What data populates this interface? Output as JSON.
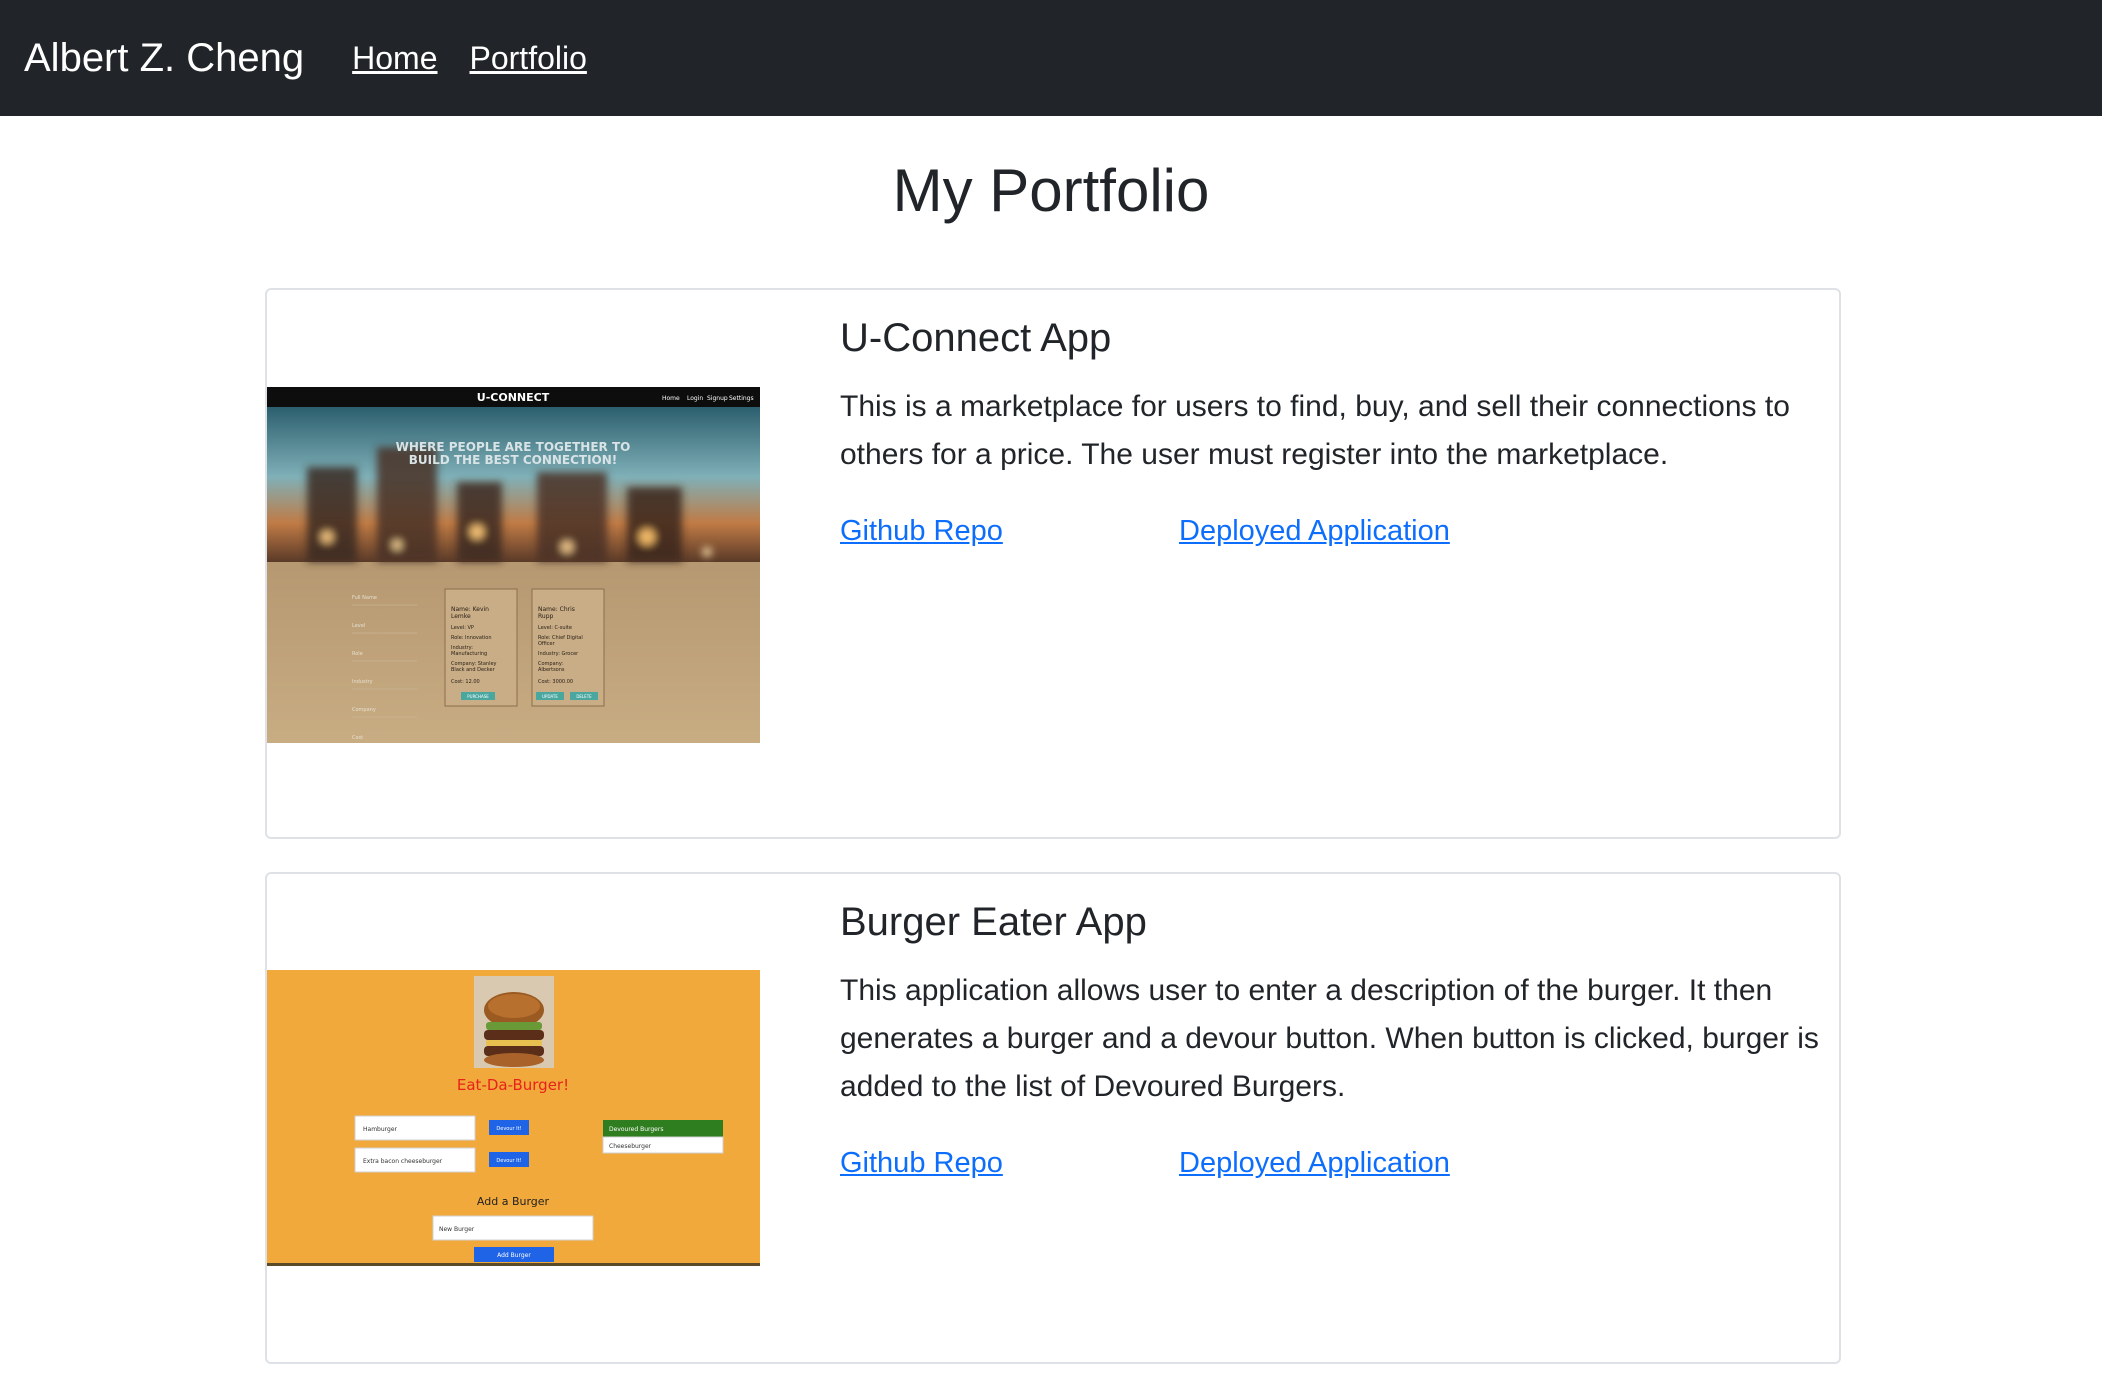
{
  "navbar": {
    "brand": "Albert Z. Cheng",
    "links": [
      {
        "label": "Home"
      },
      {
        "label": "Portfolio"
      }
    ]
  },
  "page": {
    "title": "My Portfolio"
  },
  "projects": [
    {
      "title": "U-Connect App",
      "description": "This is a marketplace for users to find, buy, and sell their connections to others for a price. The user must register into the marketplace.",
      "repo_label": "Github Repo",
      "deploy_label": "Deployed Application",
      "screenshot": {
        "app_name": "U-CONNECT",
        "nav": [
          "Home",
          "Login",
          "Signup",
          "Settings"
        ],
        "tagline_line1": "WHERE PEOPLE ARE TOGETHER TO",
        "tagline_line2": "BUILD THE BEST CONNECTION!",
        "form_fields": [
          "Full Name",
          "Level",
          "Role",
          "Industry",
          "Company",
          "Cost"
        ],
        "cards": [
          {
            "lines": [
              "Name: Kevin",
              "Lemke",
              "Level: VP",
              "Role: Innovation",
              "Industry:",
              "Manufacturing",
              "Company: Stanley",
              "Black and Decker",
              "Cost: 12.00"
            ],
            "buttons": [
              "PURCHASE"
            ]
          },
          {
            "lines": [
              "Name: Chris",
              "Rupp",
              "Level: C-suite",
              "Role: Chief Digital",
              "Officer",
              "Industry: Grocer",
              "Company:",
              "Albertsons",
              "Cost: 3000.00"
            ],
            "buttons": [
              "UPDATE",
              "DELETE"
            ]
          }
        ]
      }
    },
    {
      "title": "Burger Eater App",
      "description": "This application allows user to enter a description of the burger. It then generates a burger and a devour button. When button is clicked, burger is added to the list of Devoured Burgers.",
      "repo_label": "Github Repo",
      "deploy_label": "Deployed Application",
      "screenshot": {
        "heading": "Eat-Da-Burger!",
        "burgers": [
          "Hamburger",
          "Extra bacon cheeseburger"
        ],
        "devour_label": "Devour It!",
        "devoured_header": "Devoured Burgers",
        "devoured_items": [
          "Cheeseburger"
        ],
        "add_heading": "Add a Burger",
        "add_placeholder": "New Burger",
        "add_button": "Add Burger"
      }
    }
  ],
  "colors": {
    "navbar_bg": "#212529",
    "link": "#0d6efd",
    "burger_bg": "#f2a93b",
    "burger_title": "#e8221b",
    "burger_button": "#1f63e6",
    "devoured_header": "#2e7d1e"
  }
}
